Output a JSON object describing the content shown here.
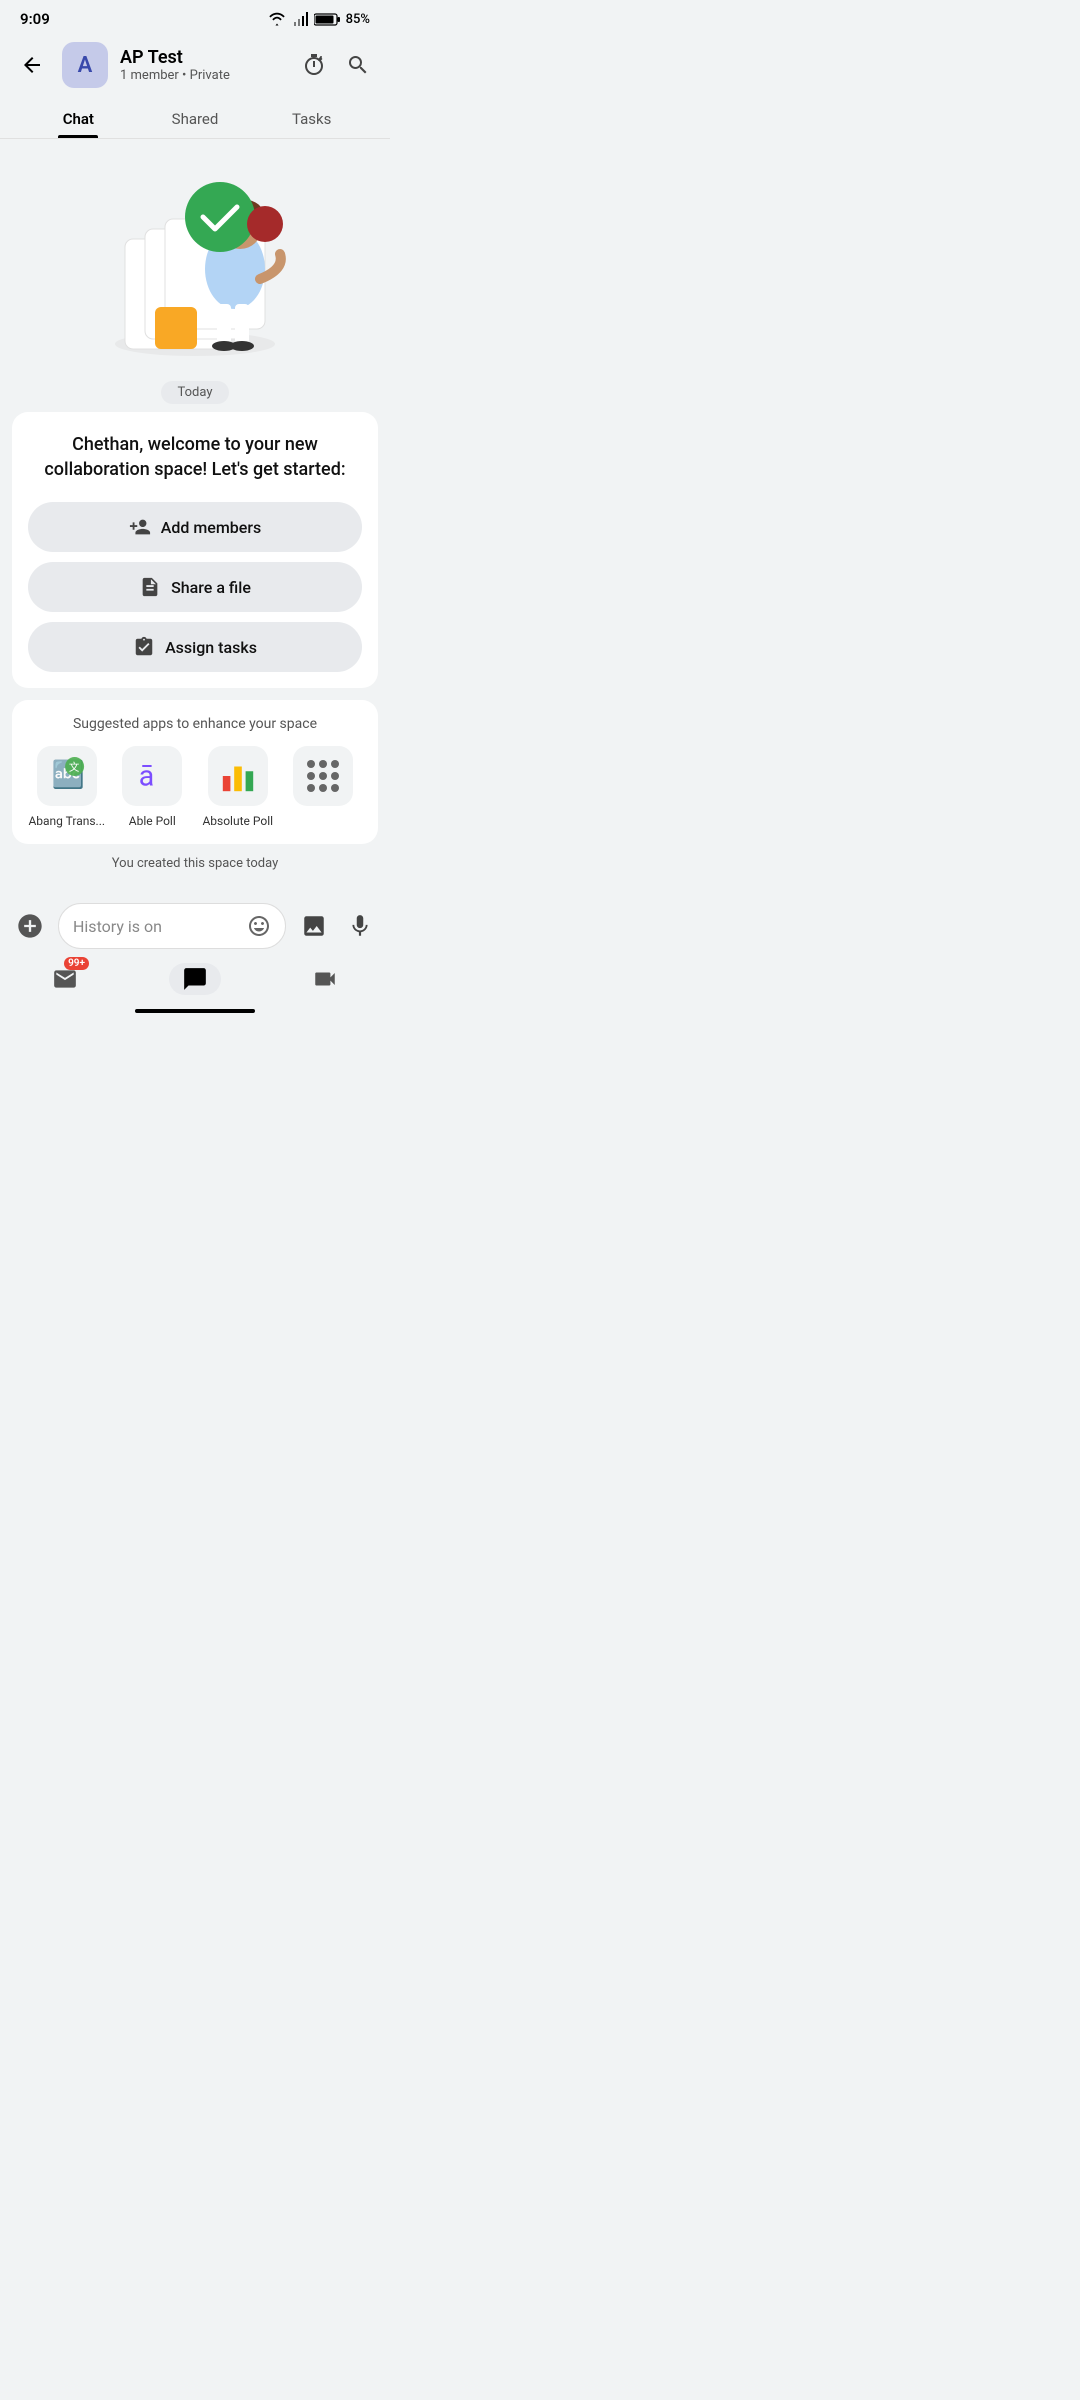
{
  "statusBar": {
    "time": "9:09",
    "battery": "85%"
  },
  "header": {
    "backLabel": "←",
    "avatarLetter": "A",
    "spaceName": "AP Test",
    "spaceMeta": "1 member • Private",
    "timerIcon": "timer-icon",
    "searchIcon": "search-icon"
  },
  "tabs": [
    {
      "id": "chat",
      "label": "Chat",
      "active": true
    },
    {
      "id": "shared",
      "label": "Shared",
      "active": false
    },
    {
      "id": "tasks",
      "label": "Tasks",
      "active": false
    }
  ],
  "dateChip": "Today",
  "welcomeCard": {
    "text": "Chethan, welcome to your new collaboration space! Let's get started:",
    "actions": [
      {
        "id": "add-members",
        "label": "Add members",
        "icon": "👤+"
      },
      {
        "id": "share-file",
        "label": "Share a file",
        "icon": "📄"
      },
      {
        "id": "assign-tasks",
        "label": "Assign tasks",
        "icon": "✓"
      }
    ]
  },
  "suggestedApps": {
    "title": "Suggested apps to enhance your space",
    "apps": [
      {
        "id": "abang-trans",
        "name": "Abang Trans...",
        "emoji": "🔤"
      },
      {
        "id": "able-poll",
        "name": "Able Poll",
        "emoji": "🅰"
      },
      {
        "id": "absolute-poll",
        "name": "Absolute Poll",
        "emoji": "📊"
      }
    ],
    "moreLabel": "More"
  },
  "createdToday": "You created this space today",
  "inputBar": {
    "placeholder": "History is on",
    "emojiIcon": "emoji-icon",
    "mediaIcon": "media-icon",
    "micIcon": "mic-icon",
    "addIcon": "add-icon"
  },
  "navBar": {
    "items": [
      {
        "id": "mail",
        "icon": "✉",
        "badge": "99+",
        "active": false
      },
      {
        "id": "chat",
        "icon": "💬",
        "active": true
      },
      {
        "id": "video",
        "icon": "📹",
        "active": false
      }
    ]
  }
}
